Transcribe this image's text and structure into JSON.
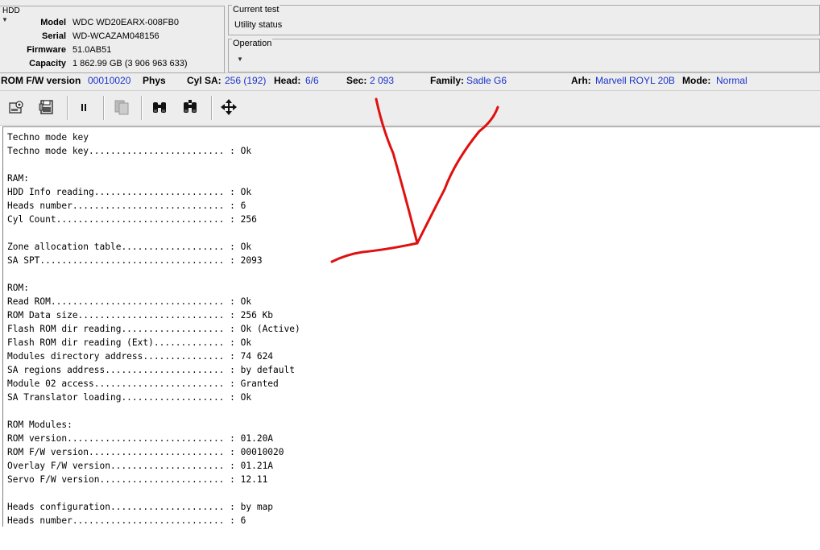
{
  "hdd": {
    "legend": "HDD",
    "fields": [
      {
        "label": "Model",
        "value": "WDC WD20EARX-008FB0"
      },
      {
        "label": "Serial",
        "value": "WD-WCAZAM048156"
      },
      {
        "label": "Firmware",
        "value": "51.0AB51"
      },
      {
        "label": "Capacity",
        "value": "1 862.99 GB (3 906 963 633)"
      }
    ]
  },
  "current_test": {
    "legend": "Current test",
    "status": "Utility status"
  },
  "operation": {
    "legend": "Operation"
  },
  "info_bar": {
    "rom_fw_label": "ROM F/W version",
    "rom_fw_value": "00010020",
    "phys_label": "Phys",
    "cyl_sa_label": "Cyl SA:",
    "cyl_sa_value": "256 (192)",
    "head_label": "Head:",
    "head_value": "6/6",
    "sec_label": "Sec:",
    "sec_value": "2 093",
    "family_label": "Family:",
    "family_value": "Sadle G6",
    "arh_label": "Arh:",
    "arh_value": "Marvell ROYL 20B",
    "mode_label": "Mode:",
    "mode_value": "Normal"
  },
  "toolbar": {
    "icons": [
      "settings-disk-icon",
      "save-disk-icon",
      "pause-icon",
      "copy-icon",
      "binoculars-icon",
      "binoculars-next-icon",
      "move-arrows-icon"
    ]
  },
  "log": {
    "lines": [
      "Techno mode key",
      "Techno mode key......................... : Ok",
      "",
      "RAM:",
      "HDD Info reading........................ : Ok",
      "Heads number............................ : 6",
      "Cyl Count............................... : 256",
      "",
      "Zone allocation table................... : Ok",
      "SA SPT.................................. : 2093",
      "",
      "ROM:",
      "Read ROM................................ : Ok",
      "ROM Data size........................... : 256 Kb",
      "Flash ROM dir reading................... : Ok (Active)",
      "Flash ROM dir reading (Ext)............. : Ok",
      "Modules directory address............... : 74 624",
      "SA regions address...................... : by default",
      "Module 02 access........................ : Granted",
      "SA Translator loading................... : Ok",
      "",
      "ROM Modules:",
      "ROM version............................. : 01.20A",
      "ROM F/W version......................... : 00010020",
      "Overlay F/W version..................... : 01.21A",
      "Servo F/W version....................... : 12.11",
      "",
      "Heads configuration..................... : by map",
      "Heads number............................ : 6"
    ]
  },
  "colors": {
    "value_blue": "#1a33cc",
    "annotation_red": "#e01010"
  }
}
